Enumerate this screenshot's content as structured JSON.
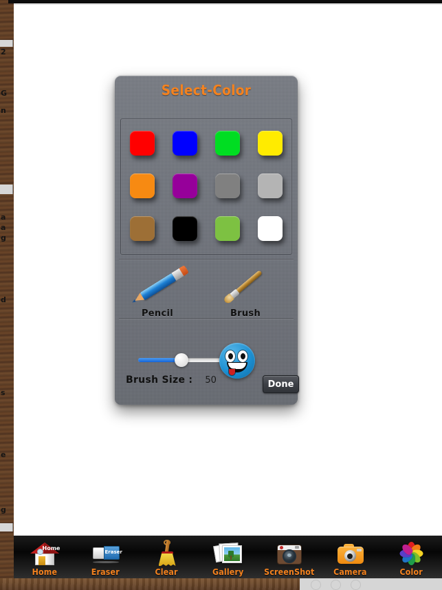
{
  "dialog": {
    "title": "Select-Color",
    "accent_color": "#f4821f",
    "panel_color": "#6f737b",
    "done_label": "Done"
  },
  "swatches": [
    {
      "name": "red",
      "hex": "#ff0000"
    },
    {
      "name": "blue",
      "hex": "#0000ff"
    },
    {
      "name": "green",
      "hex": "#00dd22"
    },
    {
      "name": "yellow",
      "hex": "#ffeb00"
    },
    {
      "name": "orange",
      "hex": "#f78a12"
    },
    {
      "name": "purple",
      "hex": "#96009a"
    },
    {
      "name": "gray",
      "hex": "#808080"
    },
    {
      "name": "light-gray",
      "hex": "#b4b4b4"
    },
    {
      "name": "brown",
      "hex": "#9d6f36"
    },
    {
      "name": "black",
      "hex": "#000000"
    },
    {
      "name": "lime",
      "hex": "#7dc142"
    },
    {
      "name": "white",
      "hex": "#ffffff"
    }
  ],
  "tools": [
    {
      "name": "pencil",
      "label": "Pencil"
    },
    {
      "name": "brush",
      "label": "Brush"
    }
  ],
  "brush_size": {
    "label": "Brush Size :",
    "value": "50",
    "percent": 48,
    "fill_color": "#1565d8"
  },
  "preview": {
    "name": "smiley-preview",
    "color": "#1c8fd1"
  },
  "toolbar": {
    "items": [
      {
        "icon": "home-icon",
        "label": "Home"
      },
      {
        "icon": "eraser-icon",
        "label": "Eraser"
      },
      {
        "icon": "broom-icon",
        "label": "Clear"
      },
      {
        "icon": "gallery-icon",
        "label": "Gallery"
      },
      {
        "icon": "screenshot-icon",
        "label": "ScreenShot"
      },
      {
        "icon": "camera-icon",
        "label": "Camera"
      },
      {
        "icon": "color-wheel-icon",
        "label": "Color"
      }
    ],
    "label_color": "#f4821f"
  },
  "background_strip": {
    "fragments": [
      "2",
      "G",
      "n",
      "a",
      "a",
      "g",
      "d",
      "s",
      "e",
      "g"
    ]
  }
}
